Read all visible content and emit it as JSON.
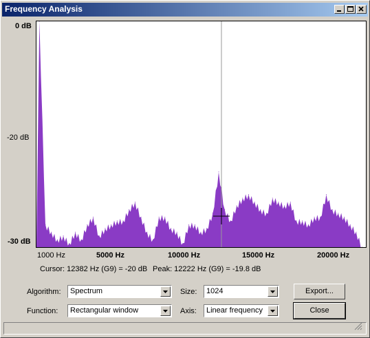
{
  "window": {
    "title": "Frequency Analysis"
  },
  "titlebar_buttons": {
    "minimize": "minimize-icon",
    "maximize": "maximize-icon",
    "close": "close-icon"
  },
  "plot": {
    "y_labels": [
      "0 dB",
      "-20 dB",
      "-30 dB"
    ],
    "x_labels": [
      "1000 Hz",
      "5000 Hz",
      "10000 Hz",
      "15000 Hz",
      "20000 Hz"
    ],
    "fill_color": "#8a3bc5",
    "cursor_line_color": "#999999"
  },
  "chart_data": {
    "type": "area",
    "x": [
      200,
      600,
      1000,
      1400,
      1800,
      2200,
      2600,
      3000,
      3400,
      3800,
      4200,
      4600,
      5000,
      5400,
      5800,
      6200,
      6600,
      7000,
      7400,
      7800,
      8200,
      8600,
      9000,
      9400,
      9800,
      10200,
      10600,
      11000,
      11400,
      11800,
      12200,
      12600,
      13000,
      13400,
      13800,
      14200,
      14600,
      15000,
      15400,
      15800,
      16200,
      16600,
      17000,
      17400,
      17800,
      18200,
      18600,
      19000,
      19400,
      19800,
      20200,
      20600,
      21000,
      21400,
      21800
    ],
    "y": [
      0,
      -27,
      -28,
      -29,
      -28.5,
      -29.5,
      -28,
      -29,
      -27,
      -26,
      -28.5,
      -27.5,
      -27,
      -26.5,
      -26.5,
      -25,
      -24,
      -26,
      -28,
      -29,
      -26,
      -26,
      -27.5,
      -28,
      -29.5,
      -27,
      -27,
      -28,
      -27.5,
      -25.5,
      -20,
      -25,
      -26.5,
      -24.5,
      -23.5,
      -23,
      -24,
      -25,
      -25.5,
      -23.5,
      -24,
      -24.5,
      -24,
      -26.5,
      -26.5,
      -27,
      -26,
      -26,
      -23,
      -25,
      -25.5,
      -26,
      -27,
      -28,
      -30
    ],
    "xlabel": "",
    "ylabel": "",
    "xlim": [
      0,
      22050
    ],
    "ylim": [
      -30,
      0
    ],
    "x_tick_labels": [
      "1000 Hz",
      "5000 Hz",
      "10000 Hz",
      "15000 Hz",
      "20000 Hz"
    ],
    "y_tick_labels": [
      "0 dB",
      "-20 dB",
      "-30 dB"
    ],
    "cursor_hz": 12382,
    "grid": false
  },
  "readout": {
    "cursor": "Cursor: 12382 Hz (G9) = -20 dB",
    "peak": "Peak: 12222 Hz (G9) = -19.8 dB"
  },
  "controls": {
    "algorithm_label": "Algorithm:",
    "algorithm_value": "Spectrum",
    "size_label": "Size:",
    "size_value": "1024",
    "function_label": "Function:",
    "function_value": "Rectangular window",
    "axis_label": "Axis:",
    "axis_value": "Linear frequency",
    "export_label": "Export...",
    "close_label": "Close"
  }
}
